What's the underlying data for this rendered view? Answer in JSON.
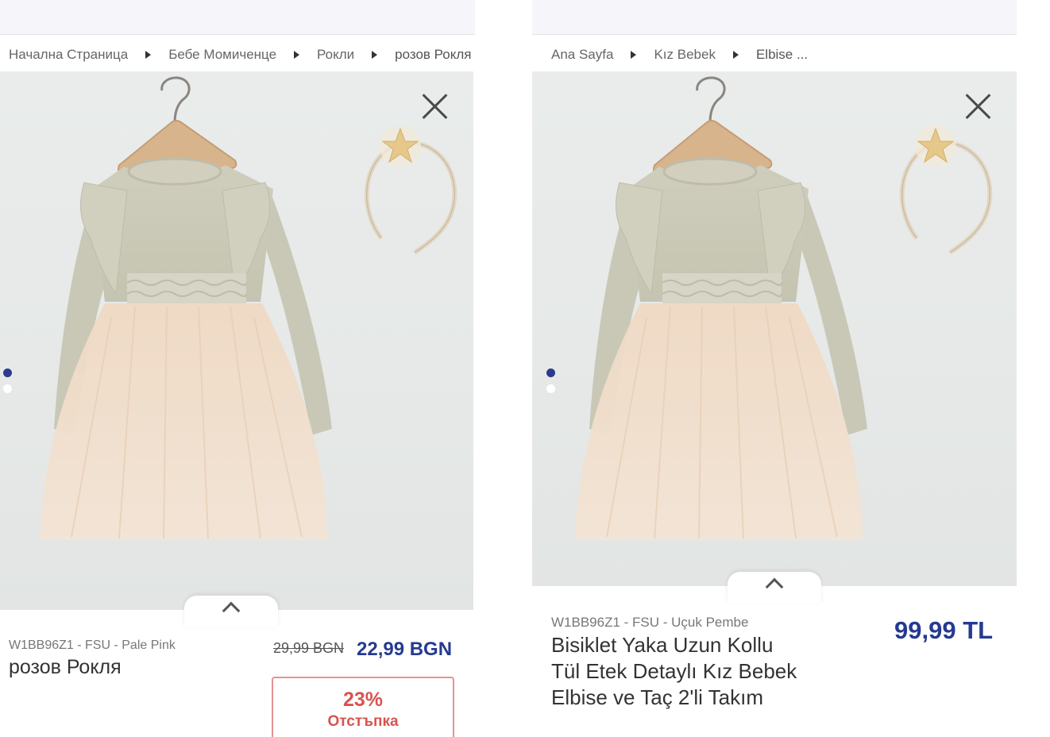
{
  "colors": {
    "price_blue": "#253a91",
    "discount_red": "#d9534f",
    "active_dot": "#2d3a8c"
  },
  "left": {
    "breadcrumb": [
      "Начална Страница",
      "Бебе Момиченце",
      "Рокли",
      "розов Рокля"
    ],
    "close_icon": "close-icon",
    "gallery": {
      "slide_count": 2,
      "active_slide": 1
    },
    "sku": "W1BB96Z1 - FSU - Pale Pink",
    "name": "розов Рокля",
    "old_price": "29,99 BGN",
    "price": "22,99 BGN",
    "discount": {
      "percent": "23%",
      "label": "Отстъпка"
    }
  },
  "right": {
    "breadcrumb": [
      "Ana Sayfa",
      "Kız Bebek",
      "Elbise ..."
    ],
    "close_icon": "close-icon",
    "gallery": {
      "slide_count": 2,
      "active_slide": 1
    },
    "sku": "W1BB96Z1 - FSU - Uçuk Pembe",
    "name": "Bisiklet Yaka Uzun Kollu Tül Etek Detaylı Kız Bebek Elbise ve Taç 2'li Takım",
    "price": "99,99 TL"
  }
}
